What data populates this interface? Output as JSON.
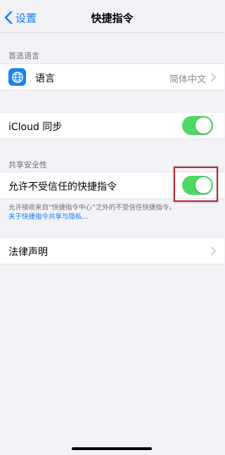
{
  "nav": {
    "back_label": "设置",
    "title": "快捷指令"
  },
  "sections": {
    "language_header": "首选语言",
    "language_row": {
      "label": "语言",
      "value": "简体中文"
    },
    "icloud_row": {
      "label": "iCloud 同步",
      "toggle_on": true
    },
    "sharing_header": "共享安全性",
    "untrusted_row": {
      "label": "允许不受信任的快捷指令",
      "toggle_on": true
    },
    "footer_text": "允许接收来自“快捷指令中心”之外的不受信任快捷指令。",
    "footer_link": "关于快捷指令共享与隐私...",
    "legal_row": {
      "label": "法律声明"
    }
  },
  "colors": {
    "accent": "#0a7aff",
    "toggle_on": "#4cd964",
    "highlight": "#b4262c",
    "background": "#f2f2f7"
  },
  "icons": {
    "back": "chevron-left-icon",
    "language": "globe-icon",
    "disclosure": "chevron-right-icon"
  }
}
